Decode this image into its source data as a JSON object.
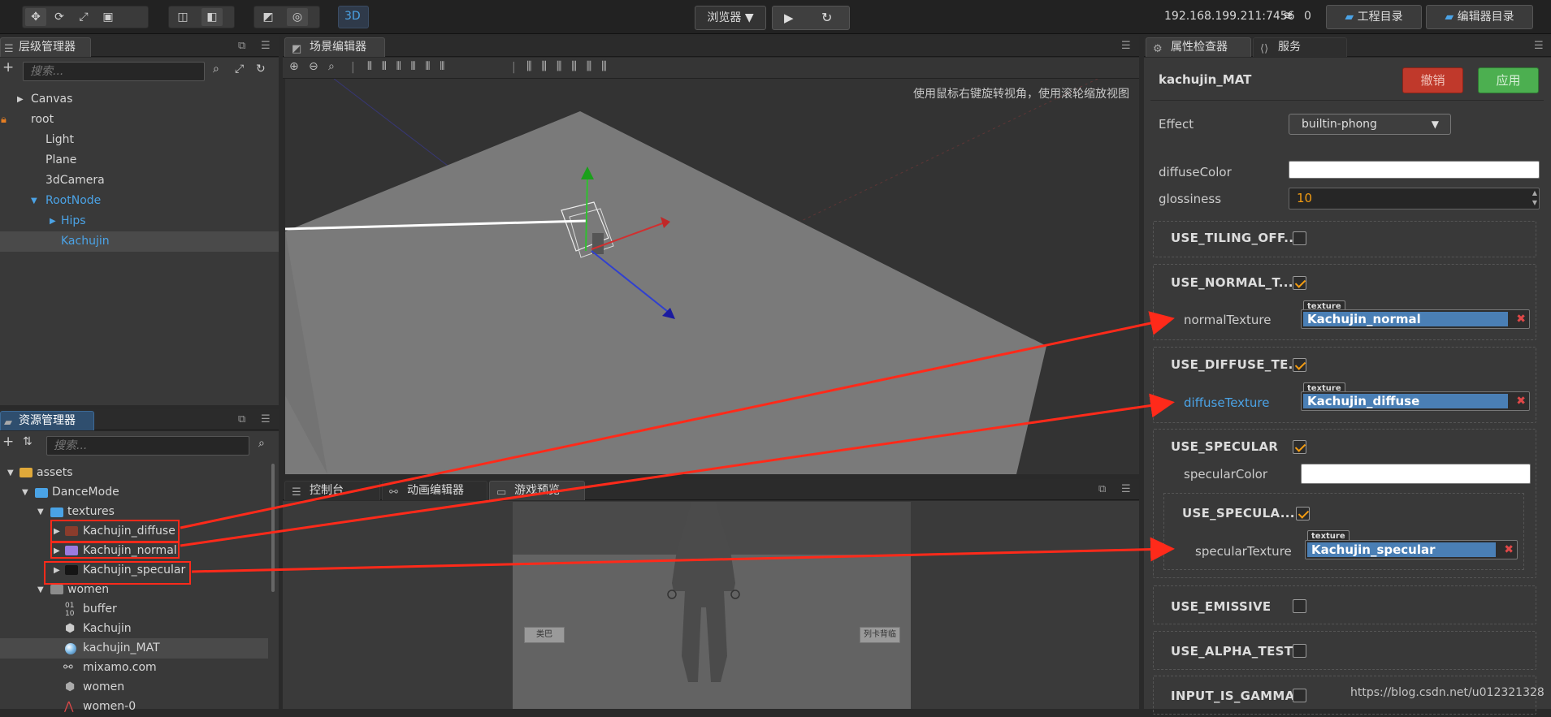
{
  "topbar": {
    "browser_label": "浏览器",
    "mode_3d": "3D",
    "ip": "192.168.199.211:7456",
    "count": "0",
    "project_dir": "工程目录",
    "editor_dir": "编辑器目录"
  },
  "hierarchy": {
    "title": "层级管理器",
    "search_placeholder": "搜索...",
    "nodes": [
      "Canvas",
      "root",
      "Light",
      "Plane",
      "3dCamera",
      "RootNode",
      "Hips",
      "Kachujin"
    ]
  },
  "assets": {
    "title": "资源管理器",
    "search_placeholder": "搜索...",
    "items": [
      "assets",
      "DanceMode",
      "textures",
      "Kachujin_diffuse",
      "Kachujin_normal",
      "Kachujin_specular",
      "women",
      "buffer",
      "Kachujin",
      "kachujin_MAT",
      "mixamo.com",
      "women",
      "women-0"
    ]
  },
  "scene": {
    "title": "场景编辑器",
    "hint": "使用鼠标右键旋转视角，使用滚轮缩放视图"
  },
  "bottom_tabs": {
    "console": "控制台",
    "animation": "动画编辑器",
    "preview": "游戏预览",
    "left_btn": "类巴",
    "right_btn": "列卡背临"
  },
  "inspector": {
    "tab_inspector": "属性检查器",
    "tab_service": "服务",
    "asset_name": "kachujin_MAT",
    "revert": "撤销",
    "apply": "应用",
    "effect_label": "Effect",
    "effect_value": "builtin-phong",
    "diffuse_color_label": "diffuseColor",
    "glossiness_label": "glossiness",
    "glossiness_value": "10",
    "use_tiling": "USE_TILING_OFF...",
    "use_normal": "USE_NORMAL_T...",
    "normal_texture_label": "normalTexture",
    "normal_texture_value": "Kachujin_normal",
    "use_diffuse": "USE_DIFFUSE_TE...",
    "diffuse_texture_label": "diffuseTexture",
    "diffuse_texture_value": "Kachujin_diffuse",
    "use_specular": "USE_SPECULAR",
    "specular_color_label": "specularColor",
    "use_specular_tex": "USE_SPECULA...",
    "specular_texture_label": "specularTexture",
    "specular_texture_value": "Kachujin_specular",
    "use_emissive": "USE_EMISSIVE",
    "use_alpha_test": "USE_ALPHA_TEST",
    "input_is_gamma": "INPUT_IS_GAMMA",
    "texture_tag": "texture",
    "watermark": "https://blog.csdn.net/u012321328"
  },
  "colors": {
    "accent_blue": "#4ba3e6",
    "annotation_red": "#ff2a1a",
    "revert_red": "#c0392b",
    "apply_green": "#4caf50",
    "check_orange": "#f39c12"
  }
}
